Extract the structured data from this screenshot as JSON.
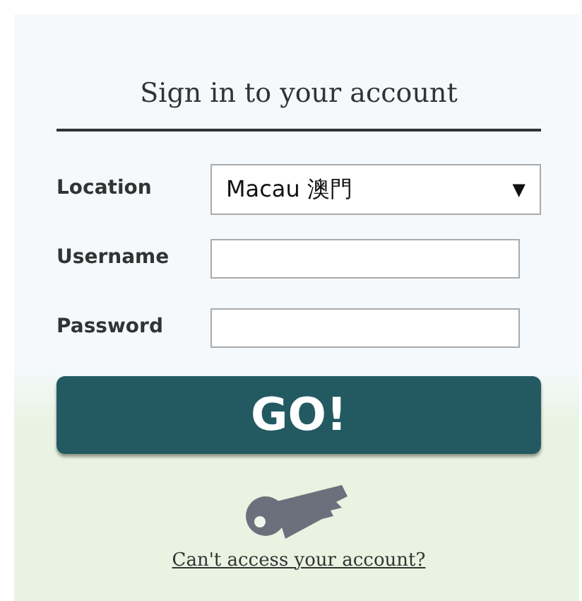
{
  "title": "Sign in to your account",
  "fields": [
    {
      "kind": "select",
      "label": "Location",
      "value": "Macau 澳門",
      "caret": "▼"
    },
    {
      "kind": "text",
      "label": "Username"
    },
    {
      "kind": "password",
      "label": "Password"
    }
  ],
  "submit": "GO!",
  "help_link": "Can't access your account?"
}
